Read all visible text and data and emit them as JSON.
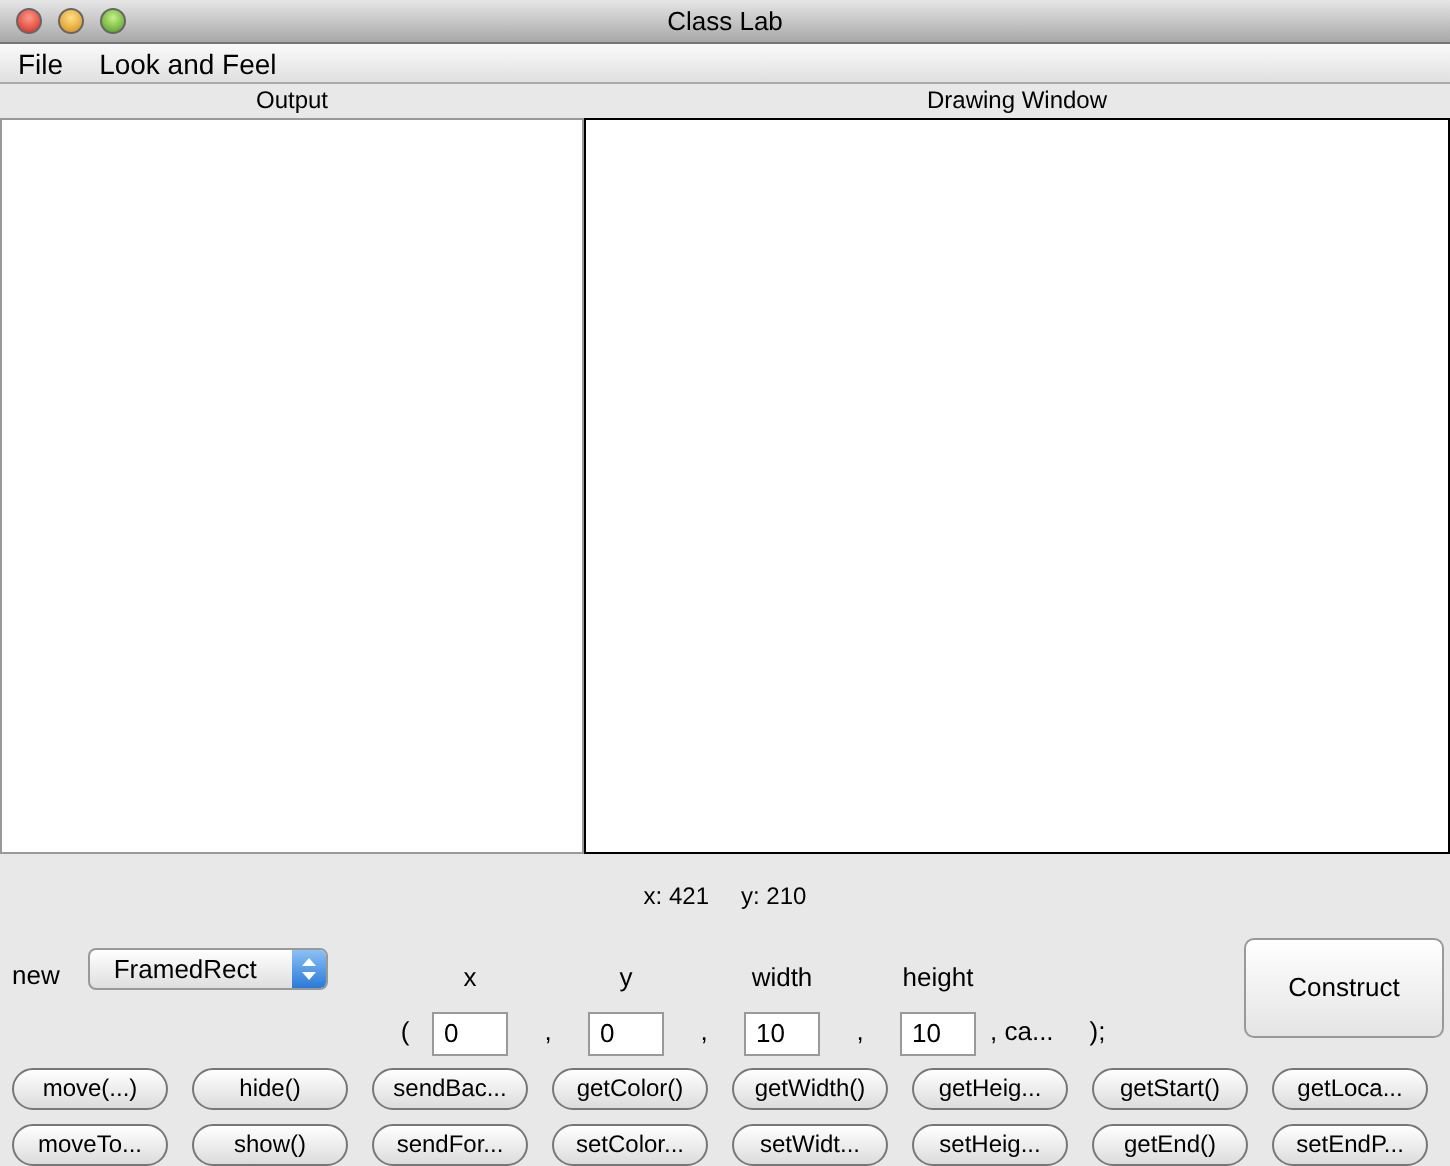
{
  "window": {
    "title": "Class Lab"
  },
  "menu": [
    "File",
    "Look and Feel"
  ],
  "panels": [
    {
      "title": "Output"
    },
    {
      "title": "Drawing Window"
    }
  ],
  "coords": {
    "x": "x: 421",
    "y": "y: 210"
  },
  "new_label": "new",
  "type_select": {
    "value": "FramedRect"
  },
  "params": [
    {
      "sep": "(",
      "label": "x",
      "value": "0"
    },
    {
      "sep": ",",
      "label": "y",
      "value": "0"
    },
    {
      "sep": ",",
      "label": "width",
      "value": "10"
    },
    {
      "sep": ",",
      "label": "height",
      "value": "10"
    }
  ],
  "tail": [
    ", ca...",
    ");"
  ],
  "construct": "Construct",
  "buttons": [
    [
      "move(...)",
      "hide()",
      "sendBac...",
      "getColor()",
      "getWidth()",
      "getHeig...",
      "getStart()",
      "getLoca..."
    ],
    [
      "moveTo...",
      "show()",
      "sendFor...",
      "setColor...",
      "setWidt...",
      "setHeig...",
      "getEnd()",
      "setEndP..."
    ]
  ]
}
